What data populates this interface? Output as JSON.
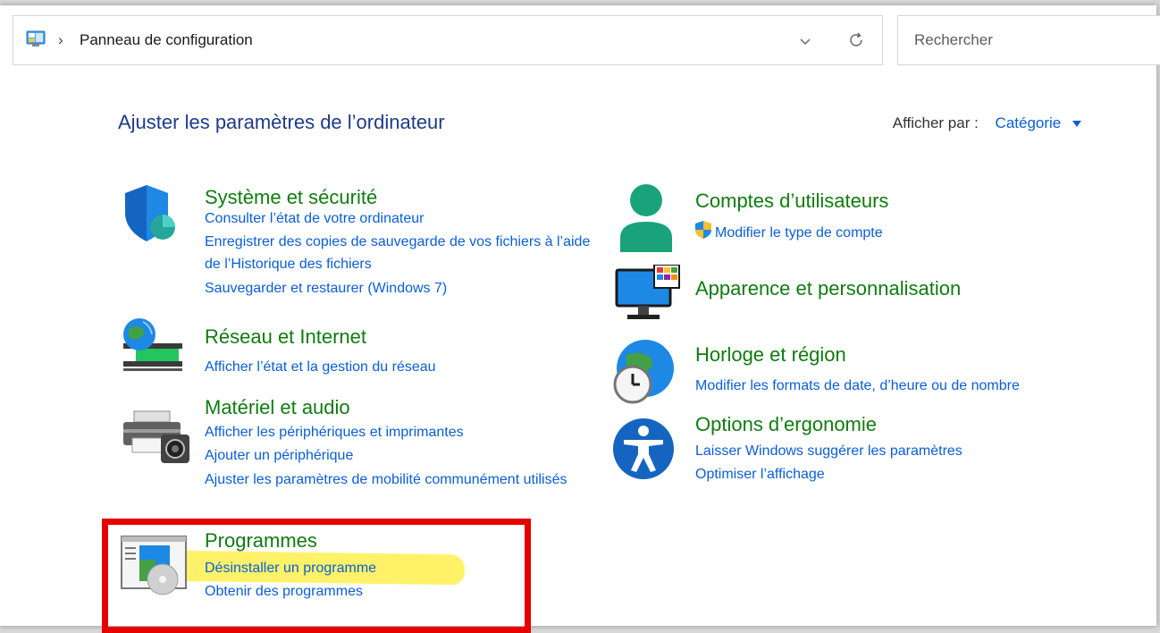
{
  "address_bar": {
    "separator": "›",
    "path": "Panneau de configuration"
  },
  "search": {
    "placeholder": "Rechercher"
  },
  "heading": "Ajuster les paramètres de l’ordinateur",
  "view_by": {
    "label": "Afficher par :",
    "value": "Catégorie"
  },
  "categories": {
    "system": {
      "title": "Système et sécurité",
      "links": [
        "Consulter l’état de votre ordinateur",
        "Enregistrer des copies de sauvegarde de vos fichiers à l’aide de l’Historique des fichiers",
        "Sauvegarder et restaurer (Windows 7)"
      ],
      "icon": "shield-icon"
    },
    "network": {
      "title": "Réseau et Internet",
      "links": [
        "Afficher l’état et la gestion du réseau"
      ],
      "icon": "globe-network-icon"
    },
    "hardware": {
      "title": "Matériel et audio",
      "links": [
        "Afficher les périphériques et imprimantes",
        "Ajouter un périphérique",
        "Ajuster les paramètres de mobilité communément utilisés"
      ],
      "icon": "printer-icon"
    },
    "programs": {
      "title": "Programmes",
      "links": [
        "Désinstaller un programme",
        "Obtenir des programmes"
      ],
      "icon": "programs-icon"
    },
    "accounts": {
      "title": "Comptes d’utilisateurs",
      "links": [
        "Modifier le type de compte"
      ],
      "icon": "user-icon"
    },
    "appearance": {
      "title": "Apparence et personnalisation",
      "links": [],
      "icon": "monitor-icon"
    },
    "clock": {
      "title": "Horloge et région",
      "links": [
        "Modifier les formats de date, d’heure ou de nombre"
      ],
      "icon": "clock-globe-icon"
    },
    "ease": {
      "title": "Options d’ergonomie",
      "links": [
        "Laisser Windows suggérer les paramètres",
        "Optimiser l’affichage"
      ],
      "icon": "accessibility-icon"
    }
  },
  "colors": {
    "category_title": "#107c10",
    "link": "#0a5ed8",
    "heading": "#1e3a8a",
    "annotation_box": "#e60000",
    "highlight": "#fff04d"
  }
}
